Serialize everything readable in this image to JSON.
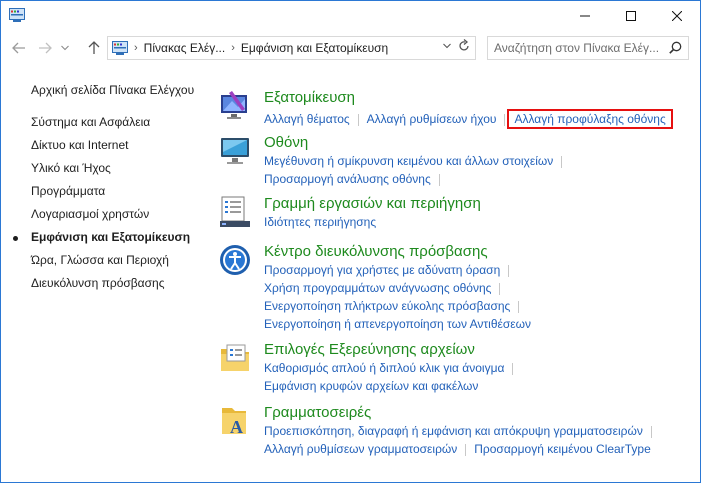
{
  "address": {
    "crumbs": [
      "Πίνακας Ελέγ...",
      "Εμφάνιση και Εξατομίκευση"
    ]
  },
  "search": {
    "placeholder": "Αναζήτηση στον Πίνακα Ελέγ..."
  },
  "sidebar": {
    "items": [
      {
        "label": "Αρχική σελίδα Πίνακα Ελέγχου"
      },
      {
        "label": "Σύστημα και Ασφάλεια"
      },
      {
        "label": "Δίκτυο και Internet"
      },
      {
        "label": "Υλικό και Ήχος"
      },
      {
        "label": "Προγράμματα"
      },
      {
        "label": "Λογαριασμοί χρηστών"
      },
      {
        "label": "Εμφάνιση και Εξατομίκευση"
      },
      {
        "label": "Ώρα, Γλώσσα και Περιοχή"
      },
      {
        "label": "Διευκόλυνση πρόσβασης"
      }
    ]
  },
  "categories": [
    {
      "title": "Εξατομίκευση",
      "links": [
        "Αλλαγή θέματος",
        "Αλλαγή ρυθμίσεων ήχου",
        "Αλλαγή προφύλαξης οθόνης"
      ]
    },
    {
      "title": "Οθόνη",
      "links": [
        "Μεγέθυνση ή σμίκρυνση κειμένου και άλλων στοιχείων",
        "Προσαρμογή ανάλυσης οθόνης"
      ]
    },
    {
      "title": "Γραμμή εργασιών και περιήγηση",
      "links": [
        "Ιδιότητες περιήγησης"
      ]
    },
    {
      "title": "Κέντρο διευκόλυνσης πρόσβασης",
      "links": [
        "Προσαρμογή για χρήστες με αδύνατη όραση",
        "Χρήση προγραμμάτων ανάγνωσης οθόνης",
        "Ενεργοποίηση πλήκτρων εύκολης πρόσβασης",
        "Ενεργοποίηση ή απενεργοποίηση των Αντιθέσεων"
      ]
    },
    {
      "title": "Επιλογές Εξερεύνησης αρχείων",
      "links": [
        "Καθορισμός απλού ή διπλού κλικ για άνοιγμα",
        "Εμφάνιση κρυφών αρχείων και φακέλων"
      ]
    },
    {
      "title": "Γραμματοσειρές",
      "links": [
        "Προεπισκόπηση, διαγραφή ή εμφάνιση και απόκρυψη γραμματοσειρών",
        "Αλλαγή ρυθμίσεων γραμματοσειρών",
        "Προσαρμογή κειμένου ClearType"
      ]
    }
  ]
}
